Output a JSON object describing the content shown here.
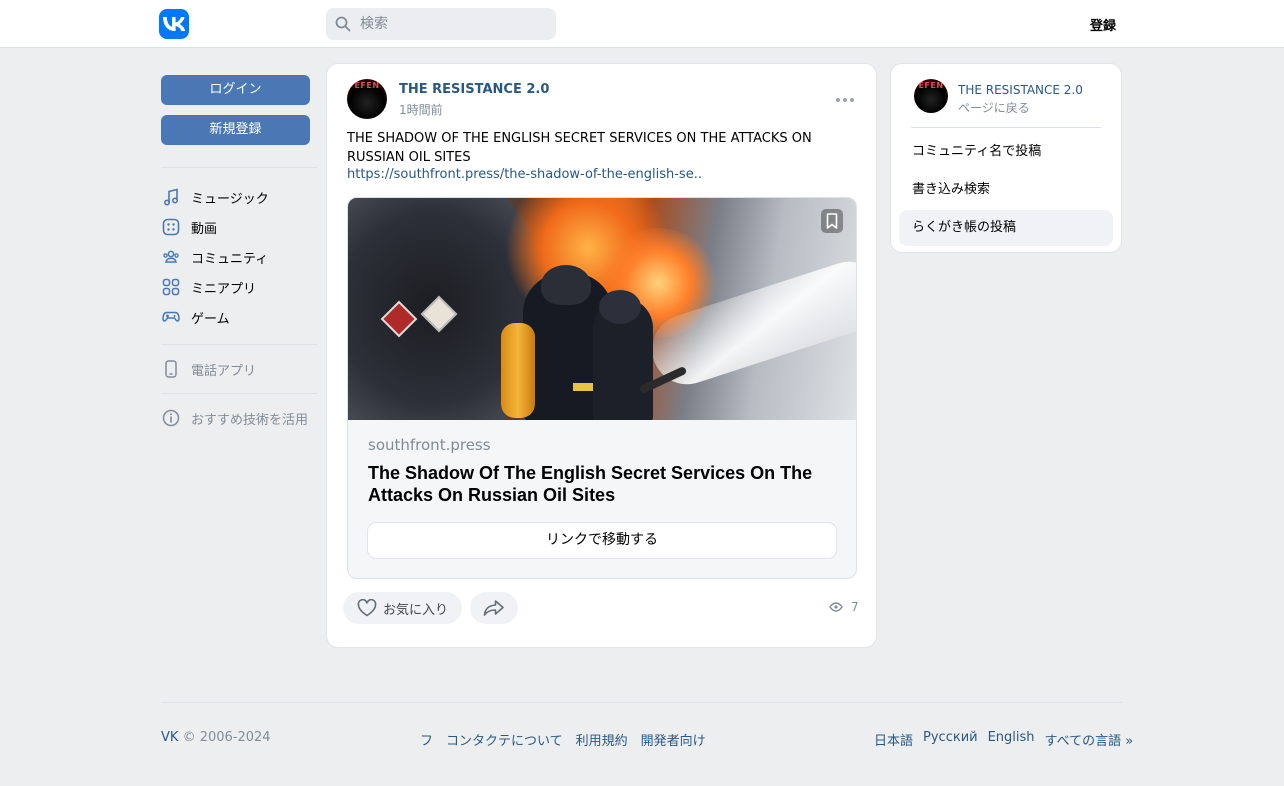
{
  "header": {
    "search_placeholder": "検索",
    "register_label": "登録"
  },
  "left": {
    "login_label": "ログイン",
    "signup_label": "新規登録",
    "nav": [
      {
        "label": "ミュージック",
        "icon": "music-icon"
      },
      {
        "label": "動画",
        "icon": "video-icon"
      },
      {
        "label": "コミュニティ",
        "icon": "community-icon"
      },
      {
        "label": "ミニアプリ",
        "icon": "mini-apps-icon"
      },
      {
        "label": "ゲーム",
        "icon": "gamepad-icon"
      }
    ],
    "phone_app": "電話アプリ",
    "recommend": "おすすめ技術を活用"
  },
  "post": {
    "author": "THE RESISTANCE 2.0",
    "avatar_text": "EFEN",
    "time": "1時間前",
    "text": "THE SHADOW OF THE ENGLISH SECRET SERVICES ON THE ATTACKS ON RUSSIAN OIL SITES",
    "link": "https://southfront.press/the-shadow-of-the-english-se..",
    "attachment": {
      "domain": "southfront.press",
      "title": "The Shadow Of The English Secret Services On The Attacks On Russian Oil Sites",
      "button": "リンクで移動する"
    },
    "like_label": "お気に入り",
    "views": "7"
  },
  "side": {
    "name": "THE RESISTANCE 2.0",
    "back": "ページに戻る",
    "items": [
      "コミュニティ名で投稿",
      "書き込み検索",
      "らくがき帳の投稿"
    ]
  },
  "footer": {
    "brand": "VK",
    "copyright": "© 2006-2024",
    "links": [
      "フ",
      "コンタクテについて",
      "利用規約",
      "開発者向け"
    ],
    "languages": [
      "日本語",
      "Русский",
      "English",
      "すべての言語 »"
    ]
  },
  "colors": {
    "accent": "#0077ff",
    "button": "#4a78b4",
    "link": "#2a5885",
    "background": "#edeef0"
  }
}
